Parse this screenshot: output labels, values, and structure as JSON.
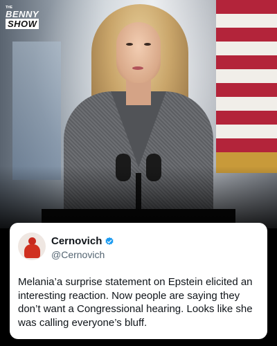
{
  "logo": {
    "prefix": "THE",
    "line1": "BENNY",
    "line2": "SHOW"
  },
  "tweet": {
    "display_name": "Cernovich",
    "handle": "@Cernovich",
    "verified_color": "#1d9bf0",
    "text": "Melania’a surprise statement on Epstein elicited an interesting reaction. Now people are saying they don’t want a Congressional hearing. Looks like she was calling everyone’s bluff."
  },
  "colors": {
    "flag_red": "#b3243a",
    "flag_white": "#f1eee9",
    "card_bg": "#ffffff"
  }
}
